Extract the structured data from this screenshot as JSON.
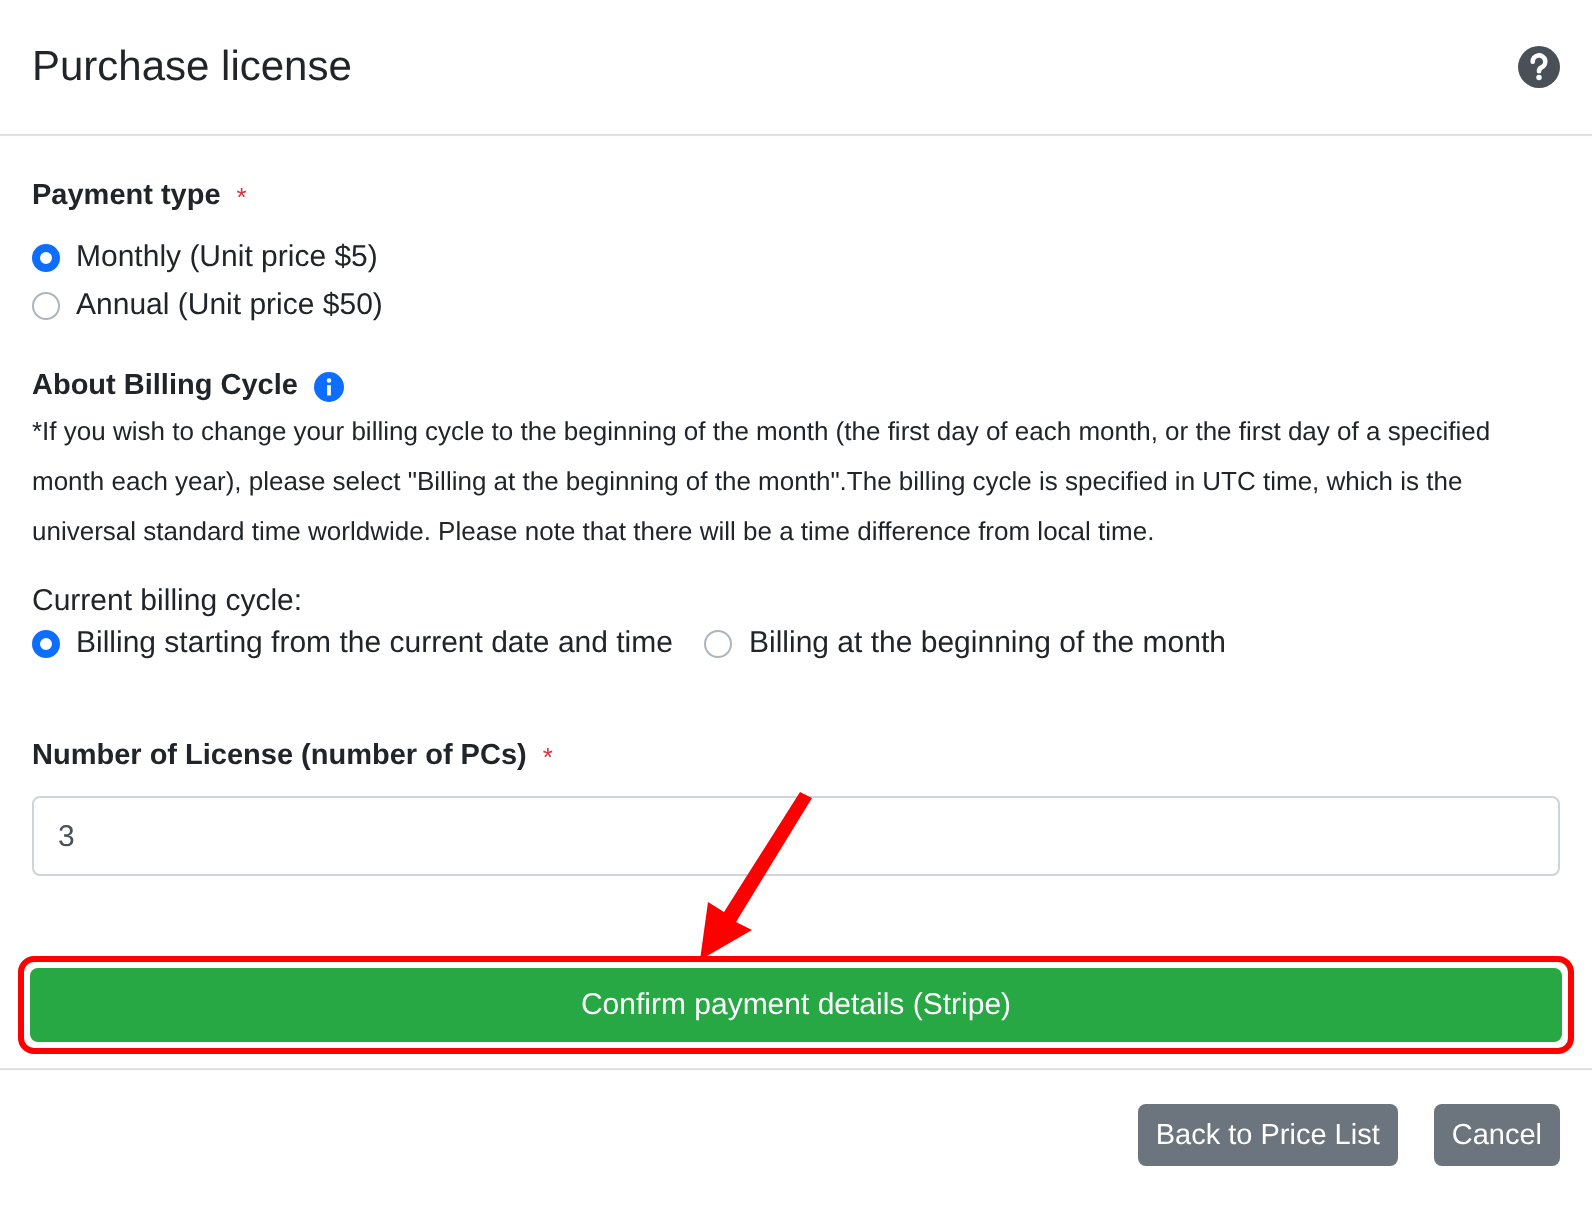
{
  "dialog": {
    "title": "Purchase license"
  },
  "payment_type": {
    "label": "Payment type",
    "required_mark": "*",
    "options": [
      {
        "label": "Monthly (Unit price $5)",
        "selected": true
      },
      {
        "label": "Annual (Unit price $50)",
        "selected": false
      }
    ]
  },
  "billing_info": {
    "heading": "About Billing Cycle",
    "note": "*If you wish to change your billing cycle to the beginning of the month (the first day of each month, or the first day of a specified month each year), please select \"Billing at the beginning of the month\".The billing cycle is specified in UTC time, which is the universal standard time worldwide. Please note that there will be a time difference from local time."
  },
  "billing_cycle": {
    "label": "Current billing cycle:",
    "options": [
      {
        "label": "Billing starting from the current date and time",
        "selected": true
      },
      {
        "label": "Billing at the beginning of the month",
        "selected": false
      }
    ]
  },
  "license_count": {
    "label": "Number of License (number of PCs)",
    "required_mark": "*",
    "value": "3"
  },
  "confirm_button": {
    "label": "Confirm payment details (Stripe)"
  },
  "footer_buttons": [
    {
      "label": "Back to Price List"
    },
    {
      "label": "Cancel"
    }
  ]
}
